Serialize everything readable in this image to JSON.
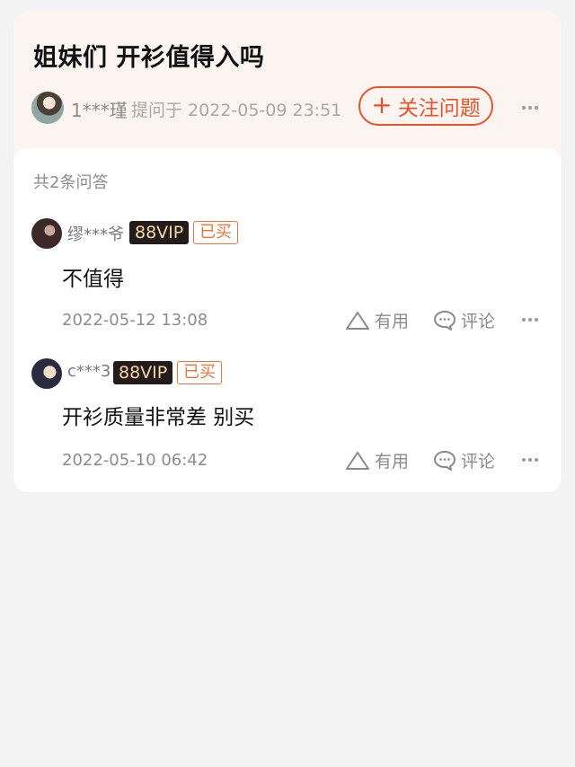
{
  "question": {
    "title": "姐妹们 开衫值得入吗",
    "asker_name": "1***瑾",
    "asked_at": "提问于 2022-05-09 23:51",
    "follow_label": "关注问题",
    "follow_icon": "plus-icon"
  },
  "answers_section": {
    "count_label": "共2条问答",
    "answers": [
      {
        "user": "缪***爷",
        "vip_badge": "88VIP",
        "bought_badge": "已买",
        "text": "不值得",
        "time": "2022-05-12 13:08",
        "useful_label": "有用",
        "comment_label": "评论"
      },
      {
        "user": "c***3",
        "vip_badge": "88VIP",
        "bought_badge": "已买",
        "text": "开衫质量非常差 别买",
        "time": "2022-05-10 06:42",
        "useful_label": "有用",
        "comment_label": "评论"
      }
    ]
  },
  "colors": {
    "accent": "#e8542a",
    "question_card_bg": "#fbf4f0",
    "page_bg": "#f3f3f3"
  }
}
